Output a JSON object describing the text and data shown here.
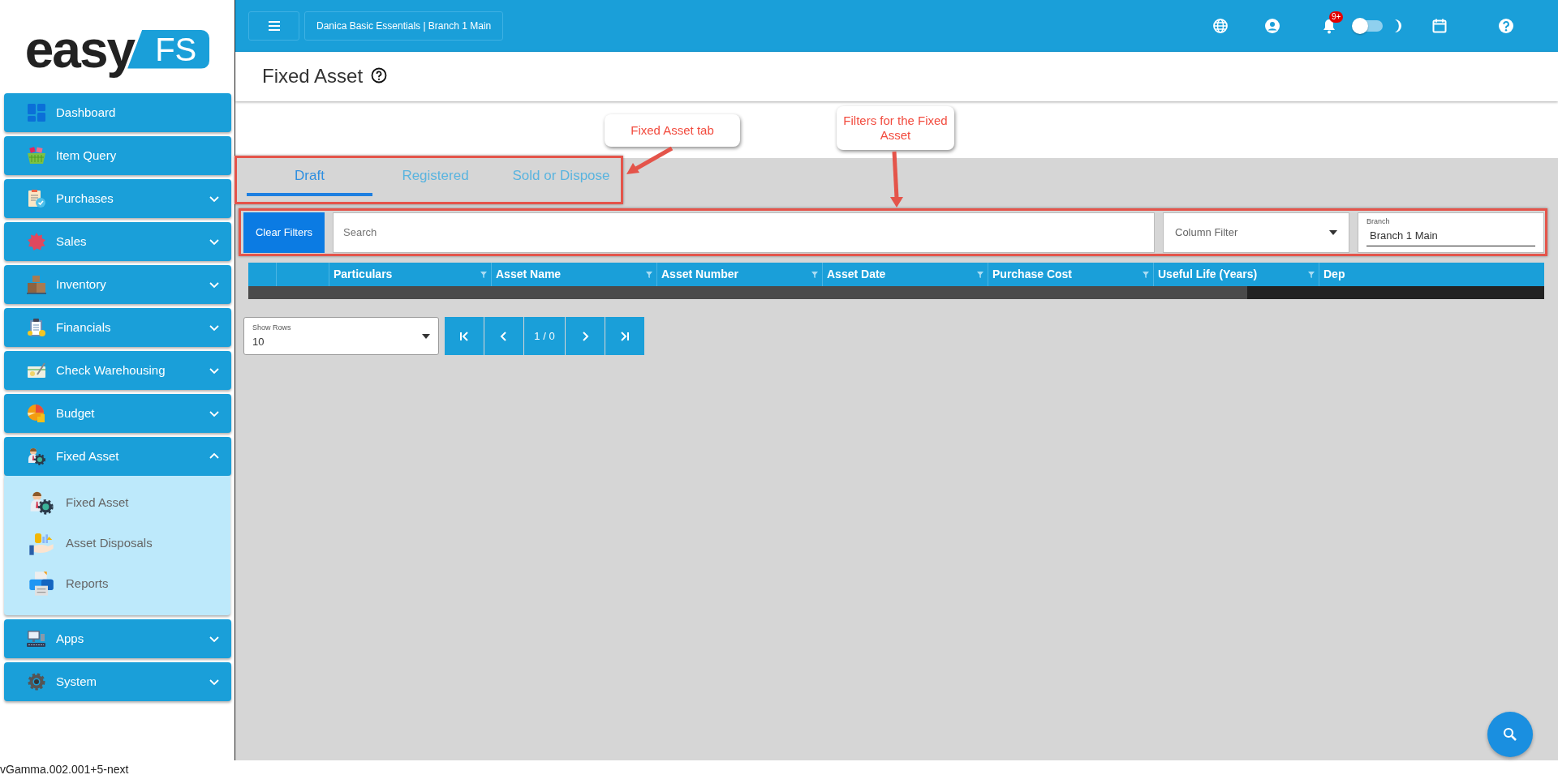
{
  "logo": {
    "word": "easy",
    "badge": "FS"
  },
  "sidebar": {
    "items": [
      {
        "label": "Dashboard",
        "kind": "link"
      },
      {
        "label": "Item Query",
        "kind": "link"
      },
      {
        "label": "Purchases",
        "kind": "group",
        "expanded": false
      },
      {
        "label": "Sales",
        "kind": "group",
        "expanded": false
      },
      {
        "label": "Inventory",
        "kind": "group",
        "expanded": false
      },
      {
        "label": "Financials",
        "kind": "group",
        "expanded": false
      },
      {
        "label": "Check Warehousing",
        "kind": "group",
        "expanded": false
      },
      {
        "label": "Budget",
        "kind": "group",
        "expanded": false
      },
      {
        "label": "Fixed Asset",
        "kind": "group",
        "expanded": true,
        "children": [
          {
            "label": "Fixed Asset"
          },
          {
            "label": "Asset Disposals"
          },
          {
            "label": "Reports"
          }
        ]
      },
      {
        "label": "Apps",
        "kind": "group",
        "expanded": false
      },
      {
        "label": "System",
        "kind": "group",
        "expanded": false
      }
    ]
  },
  "version": "vGamma.002.001+5-next",
  "topbar": {
    "company": "Danica Basic Essentials | Branch 1 Main",
    "notification_count": "9+",
    "dark_mode": false
  },
  "page_title": "Fixed Asset",
  "tabs": [
    {
      "label": "Draft",
      "selected": true
    },
    {
      "label": "Registered",
      "selected": false
    },
    {
      "label": "Sold or Dispose",
      "selected": false
    }
  ],
  "filters": {
    "clear_button": "Clear Filters",
    "search_placeholder": "Search",
    "column_filter_placeholder": "Column Filter",
    "branch": {
      "label": "Branch",
      "value": "Branch 1 Main"
    }
  },
  "table": {
    "columns": [
      "Particulars",
      "Asset Name",
      "Asset Number",
      "Asset Date",
      "Purchase Cost",
      "Useful Life (Years)",
      "Dep"
    ]
  },
  "pagination": {
    "show_rows": {
      "label": "Show Rows",
      "value": "10"
    },
    "page": "1 / 0"
  },
  "annotations": [
    {
      "text": "Fixed Asset tab"
    },
    {
      "text": "Filters for the Fixed Asset"
    }
  ]
}
